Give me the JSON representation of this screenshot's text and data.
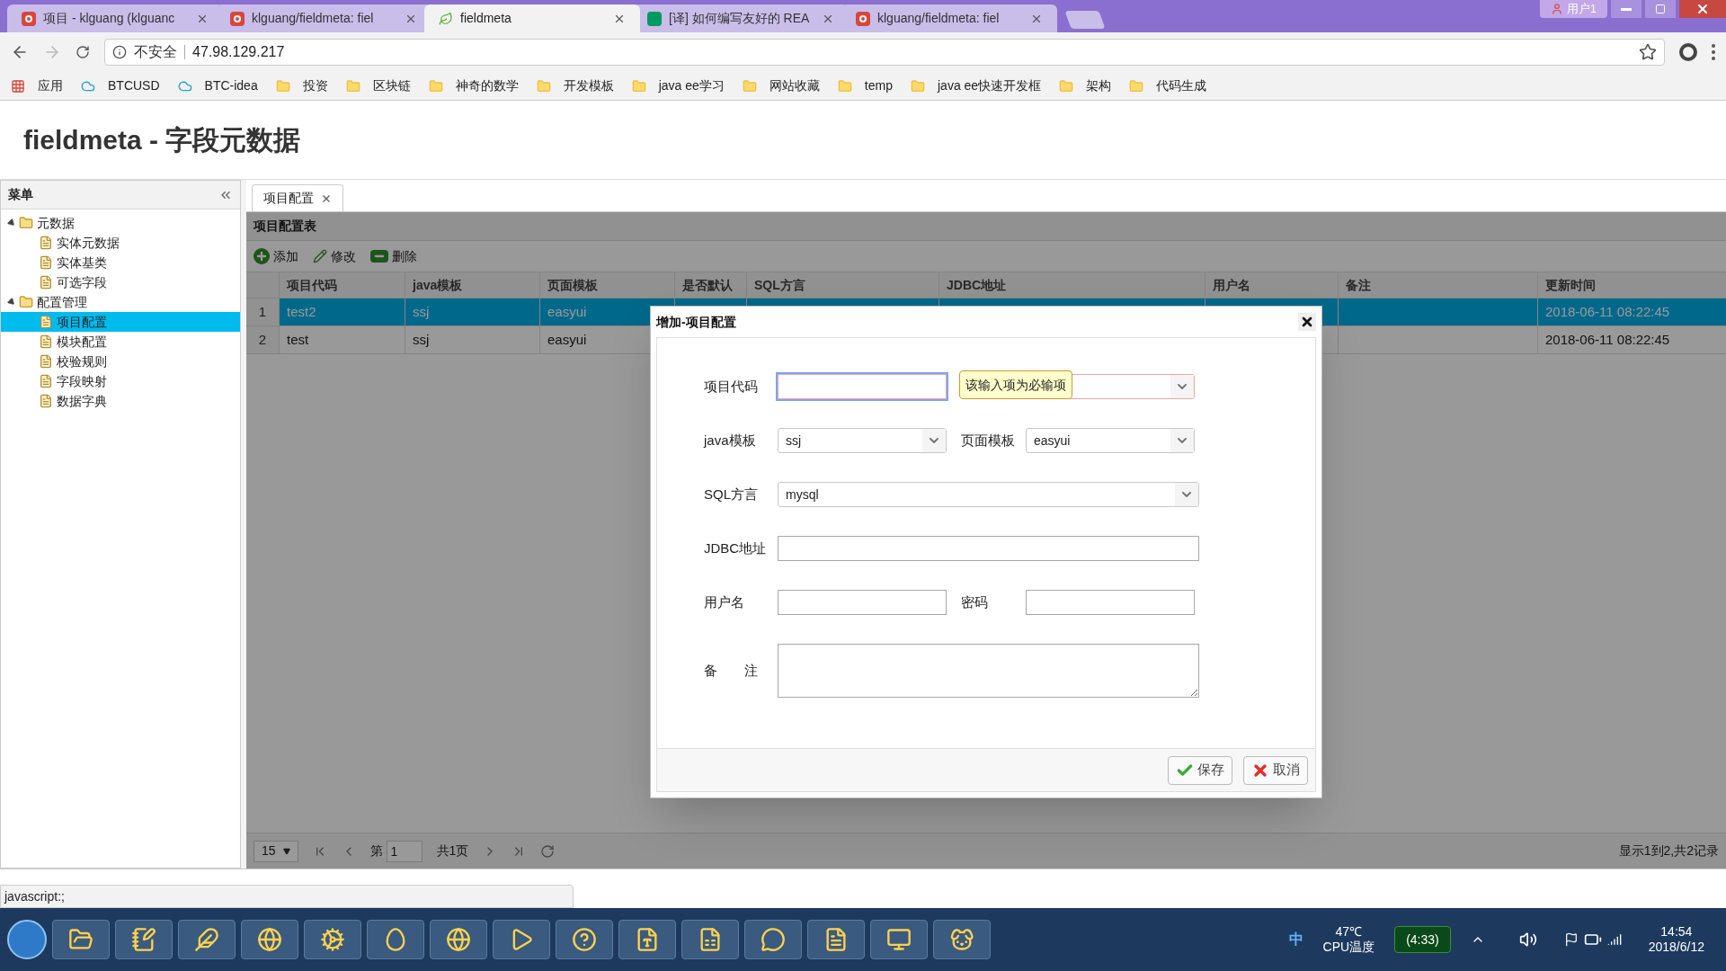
{
  "browser": {
    "tabs": [
      {
        "title": "项目 - klguang (klguanc",
        "selected": false
      },
      {
        "title": "klguang/fieldmeta: fiel",
        "selected": false
      },
      {
        "title": "fieldmeta",
        "selected": true
      },
      {
        "title": "[译] 如何编写友好的 REA",
        "selected": false
      },
      {
        "title": "klguang/fieldmeta: fiel",
        "selected": false
      }
    ],
    "user": "用户1",
    "security": "不安全",
    "address": "47.98.129.217",
    "bookmarks": [
      {
        "label": "应用",
        "kind": "apps"
      },
      {
        "label": "BTCUSD",
        "kind": "cloud"
      },
      {
        "label": "BTC-idea",
        "kind": "cloud"
      },
      {
        "label": "投资",
        "kind": "folder"
      },
      {
        "label": "区块链",
        "kind": "folder"
      },
      {
        "label": "神奇的数学",
        "kind": "folder"
      },
      {
        "label": "开发模板",
        "kind": "folder"
      },
      {
        "label": "java ee学习",
        "kind": "folder"
      },
      {
        "label": "网站收藏",
        "kind": "folder"
      },
      {
        "label": "temp",
        "kind": "folder"
      },
      {
        "label": "java ee快速开发框",
        "kind": "folder"
      },
      {
        "label": "架构",
        "kind": "folder"
      },
      {
        "label": "代码生成",
        "kind": "folder"
      }
    ]
  },
  "page": {
    "title": "fieldmeta - 字段元数据"
  },
  "sidebar": {
    "title": "菜单",
    "items": [
      {
        "label": "元数据",
        "expanded": true,
        "children": [
          {
            "label": "实体元数据",
            "selected": false
          },
          {
            "label": "实体基类",
            "selected": false
          },
          {
            "label": "可选字段",
            "selected": false
          }
        ]
      },
      {
        "label": "配置管理",
        "expanded": true,
        "children": [
          {
            "label": "项目配置",
            "selected": true
          },
          {
            "label": "模块配置",
            "selected": false
          },
          {
            "label": "校验规则",
            "selected": false
          },
          {
            "label": "字段映射",
            "selected": false
          },
          {
            "label": "数据字典",
            "selected": false
          }
        ]
      }
    ]
  },
  "content_tabs": [
    {
      "label": "项目配置",
      "selected": true
    }
  ],
  "grid": {
    "title": "项目配置表",
    "toolbar": [
      {
        "label": "添加",
        "kind": "add"
      },
      {
        "label": "修改",
        "kind": "edit"
      },
      {
        "label": "删除",
        "kind": "remove"
      }
    ],
    "columns": [
      "项目代码",
      "java模板",
      "页面模板",
      "是否默认",
      "SQL方言",
      "JDBC地址",
      "用户名",
      "备注",
      "更新时间"
    ],
    "rows": [
      {
        "number": "1",
        "selected": true,
        "cells": [
          "test2",
          "ssj",
          "easyui",
          null,
          null,
          null,
          null,
          null,
          "2018-06-11 08:22:45"
        ]
      },
      {
        "number": "2",
        "selected": false,
        "cells": [
          "test",
          "ssj",
          "easyui",
          null,
          null,
          null,
          null,
          null,
          "2018-06-11 08:22:45"
        ]
      }
    ],
    "pager": {
      "page_size": "15",
      "page_prefix": "第",
      "page": "1",
      "page_total": "共1页",
      "summary": "显示1到2,共2记录"
    }
  },
  "dialog": {
    "title": "增加-项目配置",
    "rows": [
      [
        {
          "label": "项目代码",
          "kind": "text",
          "invalid": true
        },
        {
          "kind": "combo",
          "invalid": true
        }
      ],
      [
        {
          "label": "java模板",
          "kind": "combo",
          "value": "ssj"
        },
        {
          "label": "页面模板",
          "kind": "combo",
          "value": "easyui"
        }
      ],
      [
        {
          "label": "SQL方言",
          "kind": "combo",
          "value": "mysql",
          "wide": true
        }
      ],
      [
        {
          "label": "JDBC地址",
          "kind": "text",
          "wide": true
        }
      ],
      [
        {
          "label": "用户名",
          "kind": "text"
        },
        {
          "label": "密码",
          "kind": "text"
        }
      ],
      [
        {
          "label": "备　　注",
          "kind": "textarea",
          "wide": true
        }
      ]
    ],
    "tooltip": "该输入项为必输项",
    "buttons": [
      {
        "label": "保存",
        "kind": "save"
      },
      {
        "label": "取消",
        "kind": "cancel"
      }
    ]
  },
  "status_text": "javascript:;",
  "taskbar": {
    "ime": "中",
    "temperature": "47℃",
    "temperature_label": "CPU温度",
    "battery": "(4:33)",
    "time": "14:54",
    "date": "2018/6/12"
  }
}
